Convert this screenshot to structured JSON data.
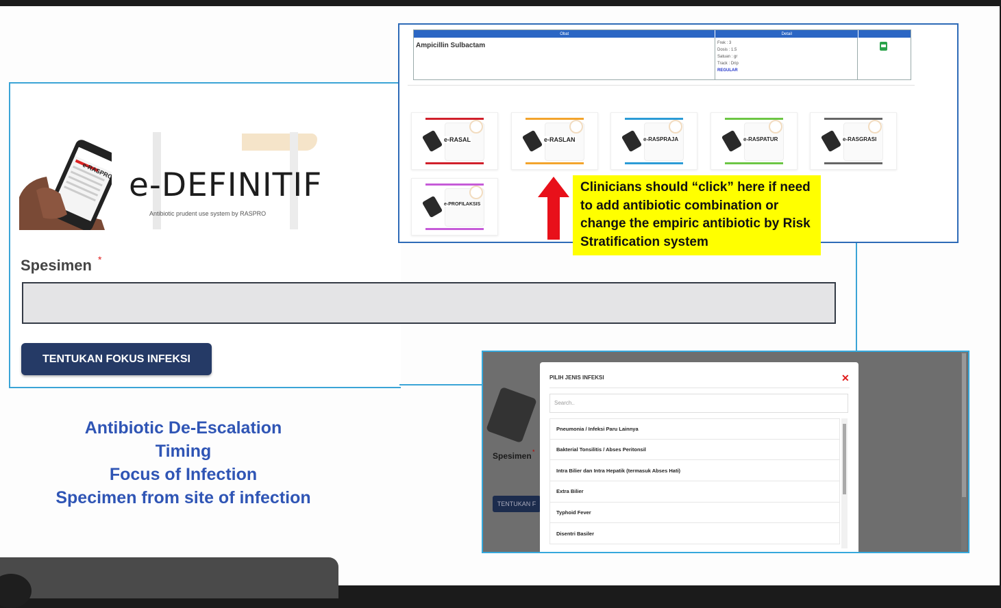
{
  "logo": {
    "title": "e-DEFINITIF",
    "subtitle": "Antibiotic prudent use system by RASPRO",
    "phone_label": "e-RASPRO"
  },
  "form": {
    "specimen_label": "Spesimen",
    "required_marker": "*",
    "specimen_value": "",
    "button_label": "TENTUKAN FOKUS INFEKSI"
  },
  "notes": [
    "Antibiotic De-Escalation",
    "Timing",
    "Focus of Infection",
    "Specimen from site of infection"
  ],
  "drug_table": {
    "headers": [
      "Obat",
      "Detail",
      ""
    ],
    "row": {
      "drug": "Ampicillin Sulbactam",
      "details": [
        "Frek     : 3",
        "Dosis    : 1.5",
        "Satuan  : gr",
        "Track    : Drip"
      ],
      "badge": "REGULAR",
      "action_icon": "printer-icon"
    }
  },
  "tiles": [
    {
      "label": "e-RASAL",
      "color": "#d1202b"
    },
    {
      "label": "e-RASLAN",
      "color": "#f3a42c"
    },
    {
      "label": "e-RASPRAJA",
      "color": "#2b9bd6"
    },
    {
      "label": "e-RASPATUR",
      "color": "#6cc644"
    },
    {
      "label": "e-RASGRASI",
      "color": "#666666"
    },
    {
      "label": "e-PROFILAKSIS",
      "color": "#c65bd8"
    }
  ],
  "callout": {
    "text": "Clinicians should “click” here if need to add antibiotic combination or change the empiric antibiotic by Risk Stratification system"
  },
  "modal": {
    "title": "PILIH JENIS INFEKSI",
    "close_icon": "close-icon",
    "search_placeholder": "Search..",
    "items": [
      "Pneumonia / Infeksi Paru Lainnya",
      "Bakterial Tonsilitis / Abses Peritonsil",
      "Intra Bilier dan Intra Hepatik (termasuk Abses Hati)",
      "Extra Bilier",
      "Typhoid Fever",
      "Disentri Basiler"
    ]
  },
  "background_form": {
    "specimen_label": "Spesimen",
    "required_marker": "*",
    "button_label": "TENTUKAN F"
  },
  "colors": {
    "frame_blue": "#3aa4d6",
    "button_navy": "#253a66",
    "notes_blue": "#2f55b5",
    "callout_yellow": "#ffff00",
    "arrow_red": "#e8101a"
  }
}
